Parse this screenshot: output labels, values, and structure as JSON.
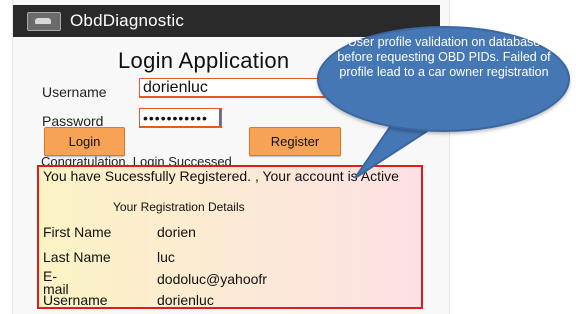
{
  "app": {
    "title": "ObdDiagnostic",
    "icon": "car-icon"
  },
  "login_form": {
    "heading": "Login Application",
    "username_label": "Username",
    "username_value": "dorienluc",
    "password_label": "Password",
    "password_value": "•••••••••••",
    "login_label": "Login",
    "register_label": "Register",
    "status_text": "Congratulation, Login Successed"
  },
  "registration": {
    "message": "You have Sucessfully Registered. , Your account is Active",
    "details_title": "Your Registration Details",
    "rows": [
      {
        "label": "First Name",
        "value": "dorien"
      },
      {
        "label": "Last Name",
        "value": "luc"
      },
      {
        "label": "E-\nmail",
        "value": "dodoluc@yahoofr"
      },
      {
        "label": "Username",
        "value": "dorienluc"
      }
    ]
  },
  "callout": {
    "text": "User profile validation on database before requesting OBD PIDs. Failed of profile lead to a car owner registration"
  },
  "colors": {
    "titlebar": "#2a2a2a",
    "button": "#f7a356",
    "input_border": "#e65a1f",
    "highlight_border": "#e01b1b",
    "callout": "#4577b5"
  }
}
